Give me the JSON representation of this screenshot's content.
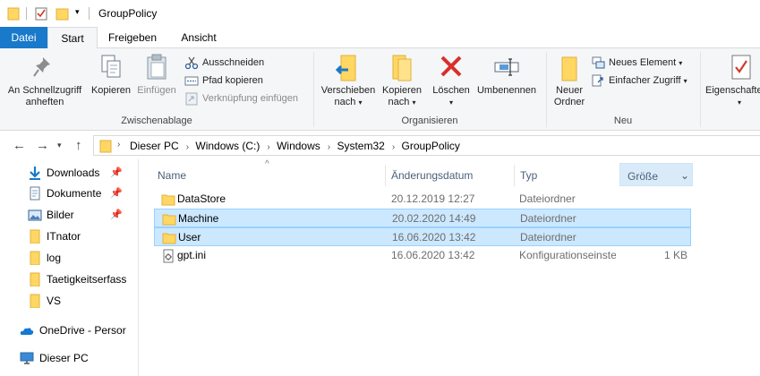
{
  "window": {
    "title": "GroupPolicy"
  },
  "ribbon_tabs": [
    {
      "label": "Datei"
    },
    {
      "label": "Start"
    },
    {
      "label": "Freigeben"
    },
    {
      "label": "Ansicht"
    }
  ],
  "ribbon": {
    "clipboard": {
      "pin_label_1": "An Schnellzugriff",
      "pin_label_2": "anheften",
      "copy_label": "Kopieren",
      "paste_label": "Einfügen",
      "cut_label": "Ausschneiden",
      "copy_path_label": "Pfad kopieren",
      "paste_shortcut_label": "Verknüpfung einfügen",
      "group_label": "Zwischenablage"
    },
    "organize": {
      "move_label_1": "Verschieben",
      "move_label_2": "nach",
      "copyto_label_1": "Kopieren",
      "copyto_label_2": "nach",
      "delete_label": "Löschen",
      "rename_label": "Umbenennen",
      "group_label": "Organisieren"
    },
    "new": {
      "new_folder_label_1": "Neuer",
      "new_folder_label_2": "Ordner",
      "new_item_label": "Neues Element",
      "easy_access_label": "Einfacher Zugriff",
      "group_label": "Neu"
    },
    "open": {
      "properties_label": "Eigenschaften"
    }
  },
  "address": {
    "crumbs": [
      "Dieser PC",
      "Windows (C:)",
      "Windows",
      "System32",
      "GroupPolicy"
    ]
  },
  "nav": {
    "items": [
      {
        "label": "Downloads",
        "icon": "download-icon",
        "pinned": true
      },
      {
        "label": "Dokumente",
        "icon": "documents-icon",
        "pinned": true
      },
      {
        "label": "Bilder",
        "icon": "pictures-icon",
        "pinned": true
      },
      {
        "label": "ITnator",
        "icon": "folder-icon",
        "pinned": false
      },
      {
        "label": "log",
        "icon": "folder-icon",
        "pinned": false
      },
      {
        "label": "Taetigkeitserfass",
        "icon": "folder-icon",
        "pinned": false
      },
      {
        "label": "VS",
        "icon": "folder-icon",
        "pinned": false
      },
      {
        "label": "OneDrive - Persor",
        "icon": "onedrive-icon",
        "pinned": false
      },
      {
        "label": "Dieser PC",
        "icon": "this-pc-icon",
        "pinned": false
      }
    ]
  },
  "columns": {
    "name": "Name",
    "date": "Änderungsdatum",
    "type": "Typ",
    "size": "Größe"
  },
  "files": [
    {
      "name": "DataStore",
      "date": "20.12.2019 12:27",
      "type": "Dateiordner",
      "size": "",
      "icon": "folder-icon",
      "selected": false
    },
    {
      "name": "Machine",
      "date": "20.02.2020 14:49",
      "type": "Dateiordner",
      "size": "",
      "icon": "folder-icon",
      "selected": true
    },
    {
      "name": "User",
      "date": "16.06.2020 13:42",
      "type": "Dateiordner",
      "size": "",
      "icon": "folder-icon",
      "selected": true
    },
    {
      "name": "gpt.ini",
      "date": "16.06.2020 13:42",
      "type": "Konfigurationseinstellungen",
      "size": "1 KB",
      "icon": "ini-file-icon",
      "selected": false
    }
  ],
  "colors": {
    "accent": "#1979ca",
    "selection": "#cce8ff",
    "selection_border": "#99d1ff",
    "folder": "#ffd762"
  }
}
